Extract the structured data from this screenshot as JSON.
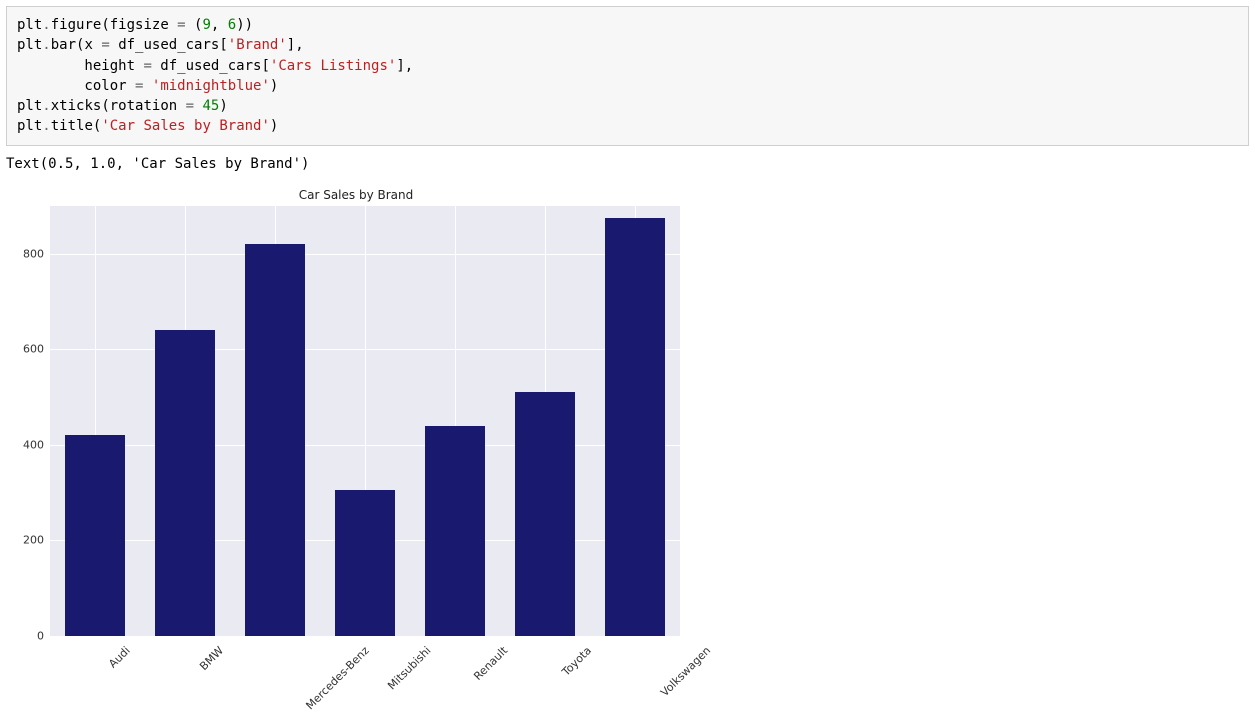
{
  "code_lines": [
    [
      [
        "plt",
        "call"
      ],
      [
        ".",
        "op"
      ],
      [
        "figure",
        "call"
      ],
      [
        "(figsize ",
        "call"
      ],
      [
        "=",
        "op"
      ],
      [
        " (",
        "call"
      ],
      [
        "9",
        "num"
      ],
      [
        ", ",
        "call"
      ],
      [
        "6",
        "num"
      ],
      [
        "))",
        "call"
      ]
    ],
    [
      [
        "plt",
        "call"
      ],
      [
        ".",
        "op"
      ],
      [
        "bar",
        "call"
      ],
      [
        "(x ",
        "call"
      ],
      [
        "=",
        "op"
      ],
      [
        " df_used_cars[",
        "call"
      ],
      [
        "'Brand'",
        "str"
      ],
      [
        "],",
        "call"
      ]
    ],
    [
      [
        "        height ",
        "call"
      ],
      [
        "=",
        "op"
      ],
      [
        " df_used_cars[",
        "call"
      ],
      [
        "'Cars Listings'",
        "str"
      ],
      [
        "],",
        "call"
      ]
    ],
    [
      [
        "        color ",
        "call"
      ],
      [
        "=",
        "op"
      ],
      [
        " ",
        "call"
      ],
      [
        "'midnightblue'",
        "str"
      ],
      [
        ")",
        "call"
      ]
    ],
    [
      [
        "plt",
        "call"
      ],
      [
        ".",
        "op"
      ],
      [
        "xticks",
        "call"
      ],
      [
        "(rotation ",
        "call"
      ],
      [
        "=",
        "op"
      ],
      [
        " ",
        "call"
      ],
      [
        "45",
        "num"
      ],
      [
        ")",
        "call"
      ]
    ],
    [
      [
        "plt",
        "call"
      ],
      [
        ".",
        "op"
      ],
      [
        "title",
        "call"
      ],
      [
        "(",
        "call"
      ],
      [
        "'Car Sales by Brand'",
        "str"
      ],
      [
        ")",
        "call"
      ]
    ]
  ],
  "text_output": "Text(0.5, 1.0, 'Car Sales by Brand')",
  "chart_data": {
    "type": "bar",
    "title": "Car Sales by Brand",
    "categories": [
      "Audi",
      "BMW",
      "Mercedes-Benz",
      "Mitsubishi",
      "Renault",
      "Toyota",
      "Volkswagen"
    ],
    "values": [
      420,
      640,
      820,
      305,
      440,
      510,
      875
    ],
    "y_ticks": [
      0,
      200,
      400,
      600,
      800
    ],
    "ylim": [
      0,
      900
    ],
    "bar_color": "#191970",
    "grid": true,
    "xtick_rotation": 45
  }
}
